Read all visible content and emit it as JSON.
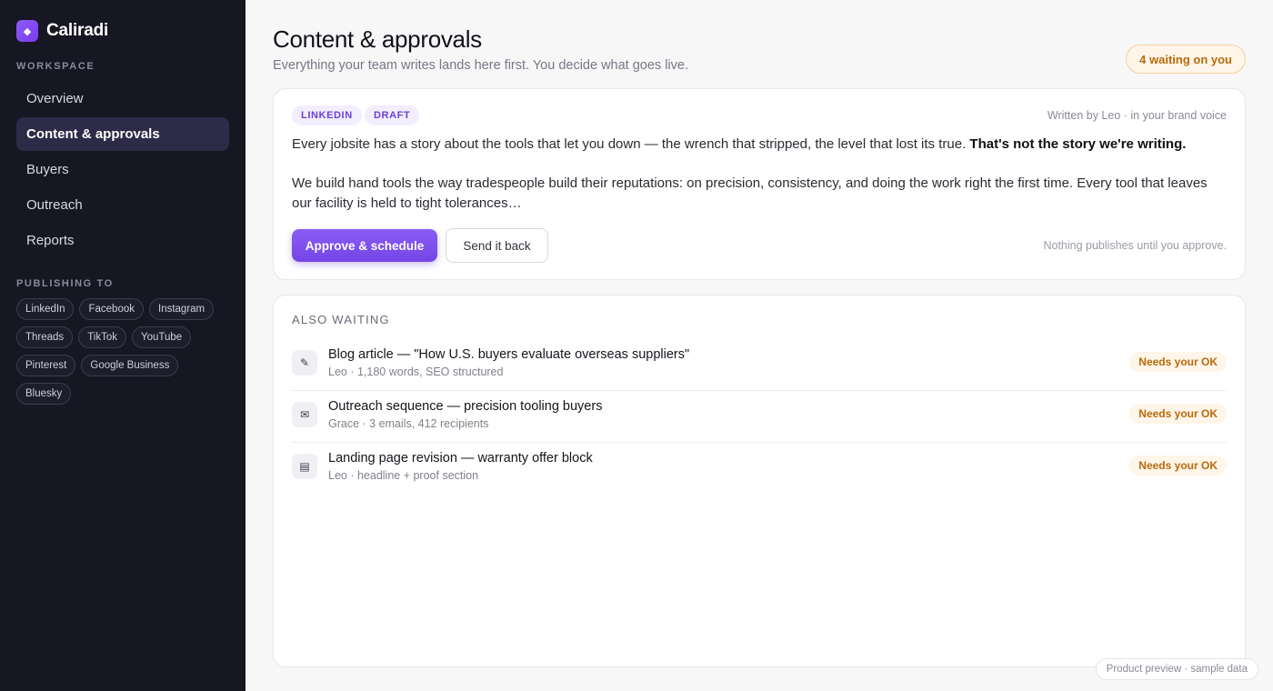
{
  "app": {
    "name": "Caliradi",
    "logo_glyph": "◆",
    "accent": "#7c3aed"
  },
  "sidebar": {
    "workspace_label": "WORKSPACE",
    "items": [
      {
        "label": "Overview",
        "active": false
      },
      {
        "label": "Content & approvals",
        "active": true
      },
      {
        "label": "Buyers",
        "active": false
      },
      {
        "label": "Outreach",
        "active": false
      },
      {
        "label": "Reports",
        "active": false
      }
    ],
    "publishing_label": "PUBLISHING TO",
    "channels": [
      "LinkedIn",
      "Facebook",
      "Instagram",
      "Threads",
      "TikTok",
      "YouTube",
      "Pinterest",
      "Google Business",
      "Bluesky"
    ]
  },
  "header": {
    "title": "Content & approvals",
    "subtitle": "Everything your team writes lands here first. You decide what goes live.",
    "waiting_badge": "4 waiting on you"
  },
  "main_post": {
    "tags": [
      "LINKEDIN",
      "DRAFT"
    ],
    "author_line": "Written by Leo · in your brand voice",
    "paragraph1": "Every jobsite has a story about the tools that let you down — the wrench that stripped, the level that lost its true.",
    "paragraph1_bold": "That's not the story we're writing.",
    "paragraph2": "We build hand tools the way tradespeople build their reputations: on precision, consistency, and doing the work right the first time. Every tool that leaves our facility is held to tight tolerances…",
    "approve_label": "Approve & schedule",
    "send_back_label": "Send it back",
    "note": "Nothing publishes until you approve."
  },
  "also_waiting": {
    "label": "ALSO WAITING",
    "items": [
      {
        "icon": "pencil-icon",
        "glyph": "✎",
        "title": "Blog article — \"How U.S. buyers evaluate overseas suppliers\"",
        "meta": "Leo · 1,180 words, SEO structured",
        "badge": "Needs your OK"
      },
      {
        "icon": "envelope-icon",
        "glyph": "✉",
        "title": "Outreach sequence — precision tooling buyers",
        "meta": "Grace · 3 emails, 412 recipients",
        "badge": "Needs your OK"
      },
      {
        "icon": "page-icon",
        "glyph": "▤",
        "title": "Landing page revision — warranty offer block",
        "meta": "Leo · headline + proof section",
        "badge": "Needs your OK"
      }
    ]
  },
  "footer": {
    "badge": "Product preview · sample data"
  }
}
